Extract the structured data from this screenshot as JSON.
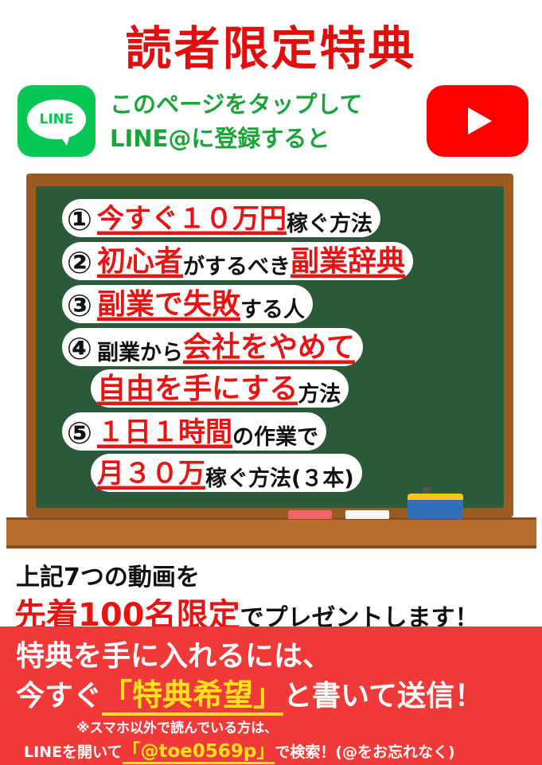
{
  "title": "読者限定特典",
  "cta": {
    "line1": "このページをタップして",
    "line2": "LINE@に登録すると"
  },
  "logos": {
    "line_text": "LINE",
    "line_color": "#06c755",
    "youtube_color": "#ff0000",
    "line_icon": "line-logo-icon",
    "youtube_icon": "youtube-play-icon"
  },
  "list": [
    {
      "num": "①",
      "parts": [
        {
          "s": "red",
          "t": "今すぐ１０万円"
        },
        {
          "s": "black",
          "t": "稼ぐ方法"
        }
      ]
    },
    {
      "num": "②",
      "parts": [
        {
          "s": "red",
          "t": "初心者"
        },
        {
          "s": "black",
          "t": "がするべき"
        },
        {
          "s": "red",
          "t": "副業辞典"
        }
      ]
    },
    {
      "num": "③",
      "parts": [
        {
          "s": "red",
          "t": "副業で失敗"
        },
        {
          "s": "black",
          "t": "する人"
        }
      ]
    },
    {
      "num": "④",
      "parts": [
        {
          "s": "black",
          "t": "副業から"
        },
        {
          "s": "red",
          "t": "会社をやめて"
        }
      ]
    },
    {
      "num": "",
      "parts": [
        {
          "s": "red",
          "t": "自由を手にする"
        },
        {
          "s": "black",
          "t": "方法"
        }
      ]
    },
    {
      "num": "⑤",
      "parts": [
        {
          "s": "red",
          "t": "１日１時間"
        },
        {
          "s": "black",
          "t": "の作業で"
        }
      ]
    },
    {
      "num": "",
      "parts": [
        {
          "s": "red",
          "t": "月３０万"
        },
        {
          "s": "black",
          "t": "稼ぐ方法(３本)"
        }
      ]
    }
  ],
  "offer": {
    "line1": "上記7つの動画を",
    "highlight": "先着100名限定",
    "rest": "でプレゼントします！"
  },
  "banner": {
    "line1": "特典を手に入れるには、",
    "line2_pre": "今すぐ",
    "line2_hl": "「特典希望」",
    "line2_post": "と書いて送信！",
    "note1": "※スマホ以外で読んでいる方は、",
    "note2_pre": "LINEを開いて",
    "note2_hl": "「@toe0569p」",
    "note2_post": "で検索！(@をお忘れなく)"
  },
  "colors": {
    "title_red": "#e10e0e",
    "cta_green": "#1aa43a",
    "chalkboard": "#2a5a3a",
    "frame": "#9a5a22",
    "banner_red": "#f03a3a",
    "highlight_yellow": "#ffe21a"
  }
}
